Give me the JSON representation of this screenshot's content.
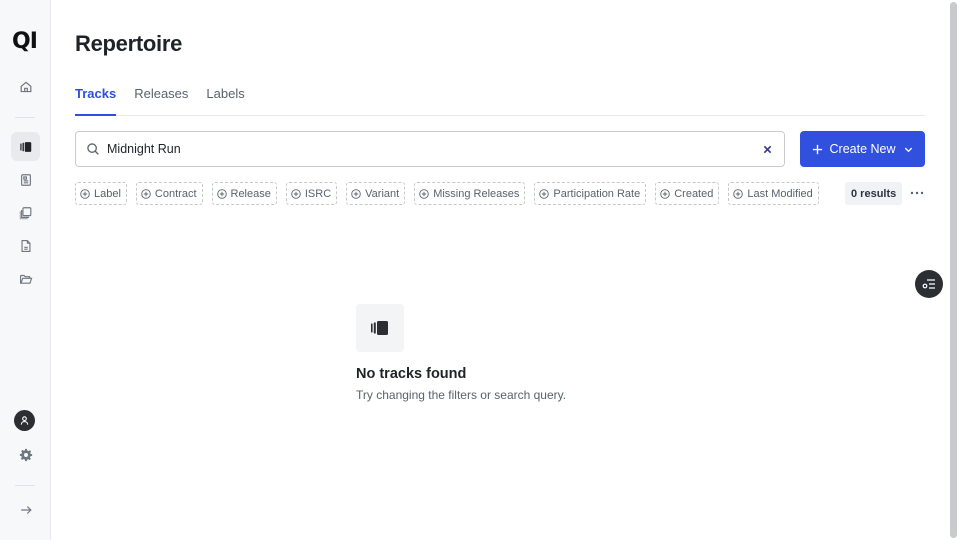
{
  "app": {
    "logo_text": "QI"
  },
  "sidebar": {
    "items": [
      {
        "name": "home",
        "icon": "home-icon"
      },
      {
        "name": "tracks",
        "icon": "tracks-icon",
        "active": true
      },
      {
        "name": "documents",
        "icon": "document-icon"
      },
      {
        "name": "stack",
        "icon": "stack-icon"
      },
      {
        "name": "file",
        "icon": "file-icon"
      },
      {
        "name": "folder",
        "icon": "folder-icon"
      }
    ],
    "bottom": [
      {
        "name": "profile",
        "icon": "user-icon"
      },
      {
        "name": "settings",
        "icon": "gear-icon"
      },
      {
        "name": "expand",
        "icon": "arrow-right-icon"
      }
    ]
  },
  "header": {
    "title": "Repertoire"
  },
  "tabs": [
    {
      "label": "Tracks",
      "active": true
    },
    {
      "label": "Releases",
      "active": false
    },
    {
      "label": "Labels",
      "active": false
    }
  ],
  "search": {
    "value": "Midnight Run",
    "placeholder": ""
  },
  "create_button": {
    "label": "Create New"
  },
  "filters": [
    {
      "label": "Label"
    },
    {
      "label": "Contract"
    },
    {
      "label": "Release"
    },
    {
      "label": "ISRC"
    },
    {
      "label": "Variant"
    },
    {
      "label": "Missing Releases"
    },
    {
      "label": "Participation Rate"
    },
    {
      "label": "Created"
    },
    {
      "label": "Last Modified"
    }
  ],
  "results": {
    "label": "0 results"
  },
  "empty_state": {
    "title": "No tracks found",
    "subtitle": "Try changing the filters or search query."
  },
  "colors": {
    "accent": "#3050dd",
    "dark": "#2b2f33"
  }
}
